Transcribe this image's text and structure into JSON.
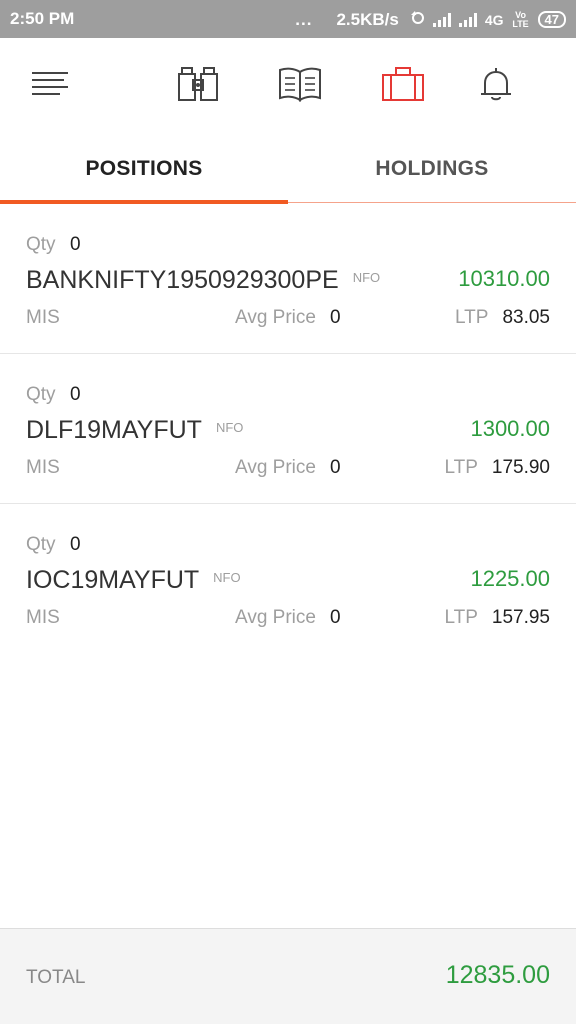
{
  "status_bar": {
    "time": "2:50 PM",
    "dots": "...",
    "speed": "2.5KB/s",
    "network": "4G",
    "volte": "Vo LTE",
    "battery": "47"
  },
  "toolbar": {
    "menu_icon": "hamburger-menu-icon",
    "items": [
      {
        "icon": "binoculars-icon",
        "active": false
      },
      {
        "icon": "book-icon",
        "active": false
      },
      {
        "icon": "briefcase-icon",
        "active": true
      },
      {
        "icon": "bell-icon",
        "active": false
      }
    ],
    "active_color": "#e53935",
    "inactive_color": "#444444"
  },
  "tabs": [
    {
      "label": "POSITIONS",
      "active": true
    },
    {
      "label": "HOLDINGS",
      "active": false
    }
  ],
  "accent_color": "#f15a22",
  "positive_color": "#2e9c3f",
  "positions": [
    {
      "qty_label": "Qty",
      "qty": "0",
      "symbol": "BANKNIFTY1950929300PE",
      "exchange": "NFO",
      "pnl": "10310.00",
      "product": "MIS",
      "avg_label": "Avg Price",
      "avg_price": "0",
      "ltp_label": "LTP",
      "ltp": "83.05"
    },
    {
      "qty_label": "Qty",
      "qty": "0",
      "symbol": "DLF19MAYFUT",
      "exchange": "NFO",
      "pnl": "1300.00",
      "product": "MIS",
      "avg_label": "Avg Price",
      "avg_price": "0",
      "ltp_label": "LTP",
      "ltp": "175.90"
    },
    {
      "qty_label": "Qty",
      "qty": "0",
      "symbol": "IOC19MAYFUT",
      "exchange": "NFO",
      "pnl": "1225.00",
      "product": "MIS",
      "avg_label": "Avg Price",
      "avg_price": "0",
      "ltp_label": "LTP",
      "ltp": "157.95"
    }
  ],
  "footer": {
    "total_label": "TOTAL",
    "total_value": "12835.00"
  }
}
